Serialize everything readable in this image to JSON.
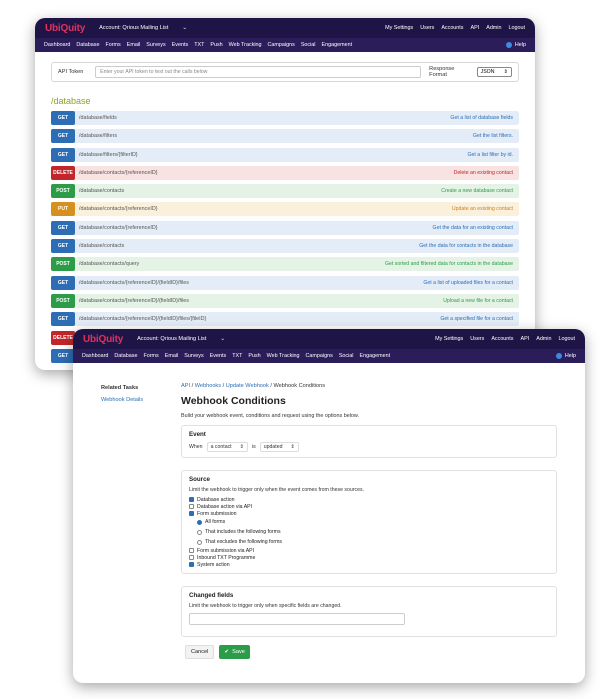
{
  "brand": "UbiQuity",
  "window1": {
    "account": "Account: Qrious Mailing List",
    "top_links": [
      "My Settings",
      "Users",
      "Accounts",
      "API",
      "Admin",
      "Logout"
    ],
    "nav": [
      "Dashboard",
      "Database",
      "Forms",
      "Email",
      "Surveys",
      "Events",
      "TXT",
      "Push",
      "Web Tracking",
      "Campaigns",
      "Social",
      "Engagement"
    ],
    "help": "Help",
    "api_token_label": "API Token",
    "api_token_placeholder": "Enter your API token to test out the calls below",
    "response_format_label": "Response Format",
    "response_format_value": "JSON",
    "section_title": "/database",
    "endpoints": [
      {
        "method": "GET",
        "path": "/database/fields",
        "desc": "Get a list of database fields"
      },
      {
        "method": "GET",
        "path": "/database/filters",
        "desc": "Get the list filters."
      },
      {
        "method": "GET",
        "path": "/database/filters/{filterID}",
        "desc": "Get a list filter by id."
      },
      {
        "method": "DELETE",
        "path": "/database/contacts/{referenceID}",
        "desc": "Delete an existing contact"
      },
      {
        "method": "POST",
        "path": "/database/contacts",
        "desc": "Create a new database contact"
      },
      {
        "method": "PUT",
        "path": "/database/contacts/{referenceID}",
        "desc": "Update an existing contact"
      },
      {
        "method": "GET",
        "path": "/database/contacts/{referenceID}",
        "desc": "Get the data for an existing contact"
      },
      {
        "method": "GET",
        "path": "/database/contacts",
        "desc": "Get the data for contacts in the database"
      },
      {
        "method": "POST",
        "path": "/database/contacts/query",
        "desc": "Get sorted and filtered data for contacts in the database"
      },
      {
        "method": "GET",
        "path": "/database/contacts/{referenceID}/{fieldID}/files",
        "desc": "Get a list of uploaded files for a contact"
      },
      {
        "method": "POST",
        "path": "/database/contacts/{referenceID}/{fieldID}/files",
        "desc": "Upload a new file for a contact"
      },
      {
        "method": "GET",
        "path": "/database/contacts/{referenceID}/{fieldID}/files/{fileID}",
        "desc": "Get a specified file for a contact"
      },
      {
        "method": "DELETE",
        "path": "",
        "desc": ""
      },
      {
        "method": "GET",
        "path": "",
        "desc": ""
      }
    ]
  },
  "window2": {
    "account": "Account: Qrious Mailing List",
    "top_links": [
      "My Settings",
      "Users",
      "Accounts",
      "API",
      "Admin",
      "Logout"
    ],
    "nav": [
      "Dashboard",
      "Database",
      "Forms",
      "Email",
      "Surveys",
      "Events",
      "TXT",
      "Push",
      "Web Tracking",
      "Campaigns",
      "Social",
      "Engagement"
    ],
    "help": "Help",
    "related_tasks": "Related Tasks",
    "webhook_details": "Webhook Details",
    "breadcrumb": [
      "API",
      "Webhooks",
      "Update Webhook"
    ],
    "breadcrumb_current": "Webhook Conditions",
    "title": "Webhook Conditions",
    "intro": "Build your webhook event, conditions and request using the options below.",
    "event": {
      "heading": "Event",
      "when": "When",
      "subject": "a contact",
      "is": "is",
      "state": "updated"
    },
    "source": {
      "heading": "Source",
      "desc": "Limit the webhook to trigger only when the event comes from these sources.",
      "options": [
        {
          "label": "Database action",
          "checked": true
        },
        {
          "label": "Database action via API",
          "checked": false
        },
        {
          "label": "Form submission",
          "checked": true
        }
      ],
      "form_options": [
        {
          "label": "All forms",
          "checked": true
        },
        {
          "label": "That includes the following forms",
          "checked": false
        },
        {
          "label": "That excludes the following forms",
          "checked": false
        }
      ],
      "options_after": [
        {
          "label": "Form submission via API",
          "checked": false
        },
        {
          "label": "Inbound TXT Programme",
          "checked": false
        },
        {
          "label": "System action",
          "checked": true
        }
      ]
    },
    "changed_fields": {
      "heading": "Changed fields",
      "desc": "Limit the webhook to trigger only when specific fields are changed."
    },
    "cancel": "Cancel",
    "save": "Save"
  }
}
